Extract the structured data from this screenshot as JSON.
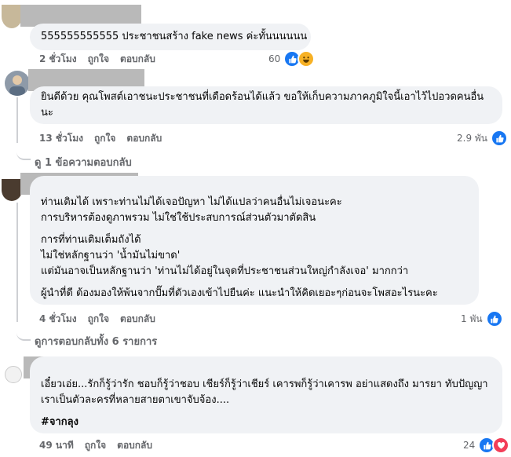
{
  "comments": [
    {
      "text": [
        "555555555555 ประชาชนสร้าง fake news ค่ะทั้นนนนนน"
      ],
      "time": "2 ชั่วโมง",
      "like_label": "ถูกใจ",
      "reply_label": "ตอบกลับ",
      "reaction_count": "60",
      "reactions": [
        "like-icon",
        "haha-icon"
      ]
    },
    {
      "text": [
        "ยินดีด้วย คุณโพสต์เอาชนะประชาชนที่เดือดร้อนได้แล้ว ขอให้เก็บความภาคภูมิใจนี้เอาไว้ไปอวดคนอื่นนะ"
      ],
      "time": "13 ชั่วโมง",
      "like_label": "ถูกใจ",
      "reply_label": "ตอบกลับ",
      "reaction_count": "2.9 พัน",
      "reactions": [
        "like-icon"
      ],
      "view_replies": "ดู 1 ข้อความตอบกลับ"
    },
    {
      "paragraphs": [
        [
          "ท่านเติมได้ เพราะท่านไม่ได้เจอปัญหา ไม่ได้แปลว่าคนอื่นไม่เจอนะคะ",
          "การบริหารต้องดูภาพรวม ไม่ใช่ใช้ประสบการณ์ส่วนตัวมาตัดสิน"
        ],
        [
          "การที่ท่านเติมเต็มถังได้",
          "ไม่ใช่หลักฐานว่า 'น้ำมันไม่ขาด'",
          "แต่มันอาจเป็นหลักฐานว่า 'ท่านไม่ได้อยู่ในจุดที่ประชาชนส่วนใหญ่กำลังเจอ' มากกว่า"
        ],
        [
          "ผู้นำที่ดี ต้องมองให้พ้นจากปั๊มที่ตัวเองเข้าไปยืนค่ะ แนะนำให้คิดเยอะๆก่อนจะโพสอะไรนะคะ"
        ]
      ],
      "time": "4 ชั่วโมง",
      "like_label": "ถูกใจ",
      "reply_label": "ตอบกลับ",
      "reaction_count": "1 พัน",
      "reactions": [
        "like-icon"
      ],
      "view_replies": "ดูการตอบกลับทั้ง 6 รายการ"
    },
    {
      "paragraphs": [
        [
          "เอี๋ยวเอ่ย...รักก็รู้ว่ารัก ชอบก็รู้ว่าชอบ เชียร์ก็รู้ว่าเชียร์ เคารพก็รู้ว่าเคารพ อย่าแสดงถึง มารยา ทับปัญญา เราเป็นตัวละครที่หลายสายตาเขาจับจ้อง...."
        ],
        [
          "#จากลุง"
        ]
      ],
      "time": "49 นาที",
      "like_label": "ถูกใจ",
      "reply_label": "ตอบกลับ",
      "reaction_count": "24",
      "reactions": [
        "like-icon",
        "love-icon"
      ]
    }
  ],
  "colors": {
    "bubble": "#f0f2f5",
    "meta_text": "#65676b",
    "like": "#1877f2",
    "love": "#f33e58",
    "haha": "#f7b125",
    "redaction": "#b9b9b9"
  }
}
